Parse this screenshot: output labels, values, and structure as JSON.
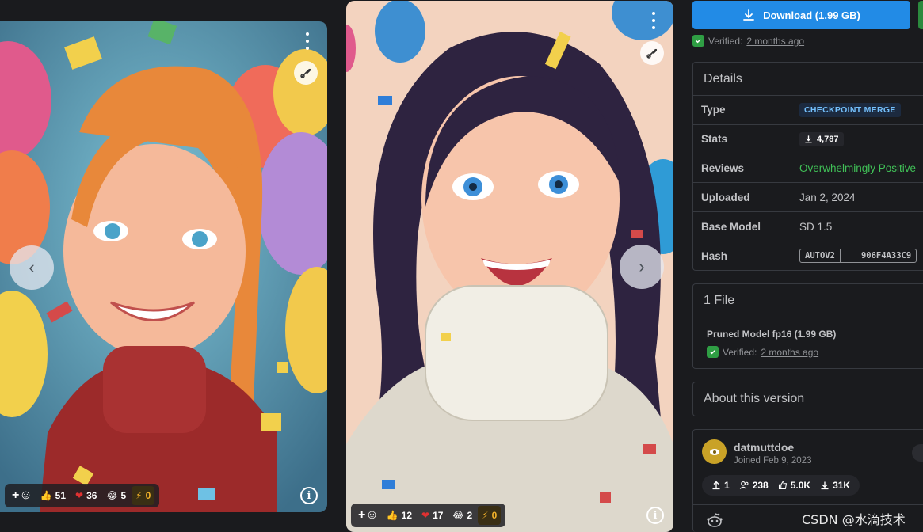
{
  "cards": [
    {
      "reactions": {
        "like": "51",
        "heart": "36",
        "laugh": "5",
        "buzz": "0"
      }
    },
    {
      "reactions": {
        "like": "12",
        "heart": "17",
        "laugh": "2",
        "buzz": "0"
      }
    }
  ],
  "nav": {
    "prev": "‹",
    "next": "›"
  },
  "download": {
    "label": "Download (1.99 GB)",
    "verified_prefix": "Verified:",
    "verified_when": "2 months ago"
  },
  "details": {
    "title": "Details",
    "rows": [
      {
        "key": "Type",
        "value": "CHECKPOINT MERGE"
      },
      {
        "key": "Stats",
        "value": "4,787"
      },
      {
        "key": "Reviews",
        "value": "Overwhelmingly Positive"
      },
      {
        "key": "Uploaded",
        "value": "Jan 2, 2024"
      },
      {
        "key": "Base Model",
        "value": "SD 1.5"
      },
      {
        "key": "Hash",
        "hash_type": "AUTOV2",
        "hash_value": "906F4A33C9"
      }
    ]
  },
  "files": {
    "title": "1 File",
    "name": "Pruned Model fp16 (1.99 GB)",
    "verified_prefix": "Verified:",
    "verified_when": "2 months ago"
  },
  "about": {
    "title": "About this version"
  },
  "creator": {
    "name": "datmuttdoe",
    "joined": "Joined Feb 9, 2023",
    "stats": {
      "uploads": "1",
      "followers": "238",
      "likes": "5.0K",
      "downloads": "31K"
    }
  },
  "watermark": "CSDN @水滴技术",
  "colors": {
    "accent": "#228be6",
    "positive": "#40c057",
    "verified": "#2f9e44"
  }
}
